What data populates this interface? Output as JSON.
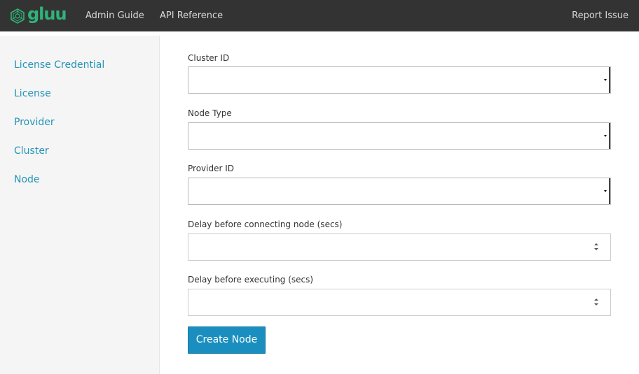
{
  "navbar": {
    "brand": "gluu",
    "links": [
      "Admin Guide",
      "API Reference"
    ],
    "report_issue": "Report Issue",
    "background": "#333333",
    "brand_color": "#2fb37a"
  },
  "sidebar": {
    "items": [
      {
        "label": "License Credential"
      },
      {
        "label": "License"
      },
      {
        "label": "Provider"
      },
      {
        "label": "Cluster"
      },
      {
        "label": "Node"
      }
    ],
    "link_color": "#2494b8"
  },
  "form": {
    "cluster_id": {
      "label": "Cluster ID",
      "value": ""
    },
    "node_type": {
      "label": "Node Type",
      "value": ""
    },
    "provider_id": {
      "label": "Provider ID",
      "value": ""
    },
    "delay_connecting": {
      "label": "Delay before connecting node (secs)",
      "value": ""
    },
    "delay_executing": {
      "label": "Delay before executing (secs)",
      "value": ""
    },
    "submit_label": "Create Node",
    "button_color": "#1a8fbf"
  }
}
